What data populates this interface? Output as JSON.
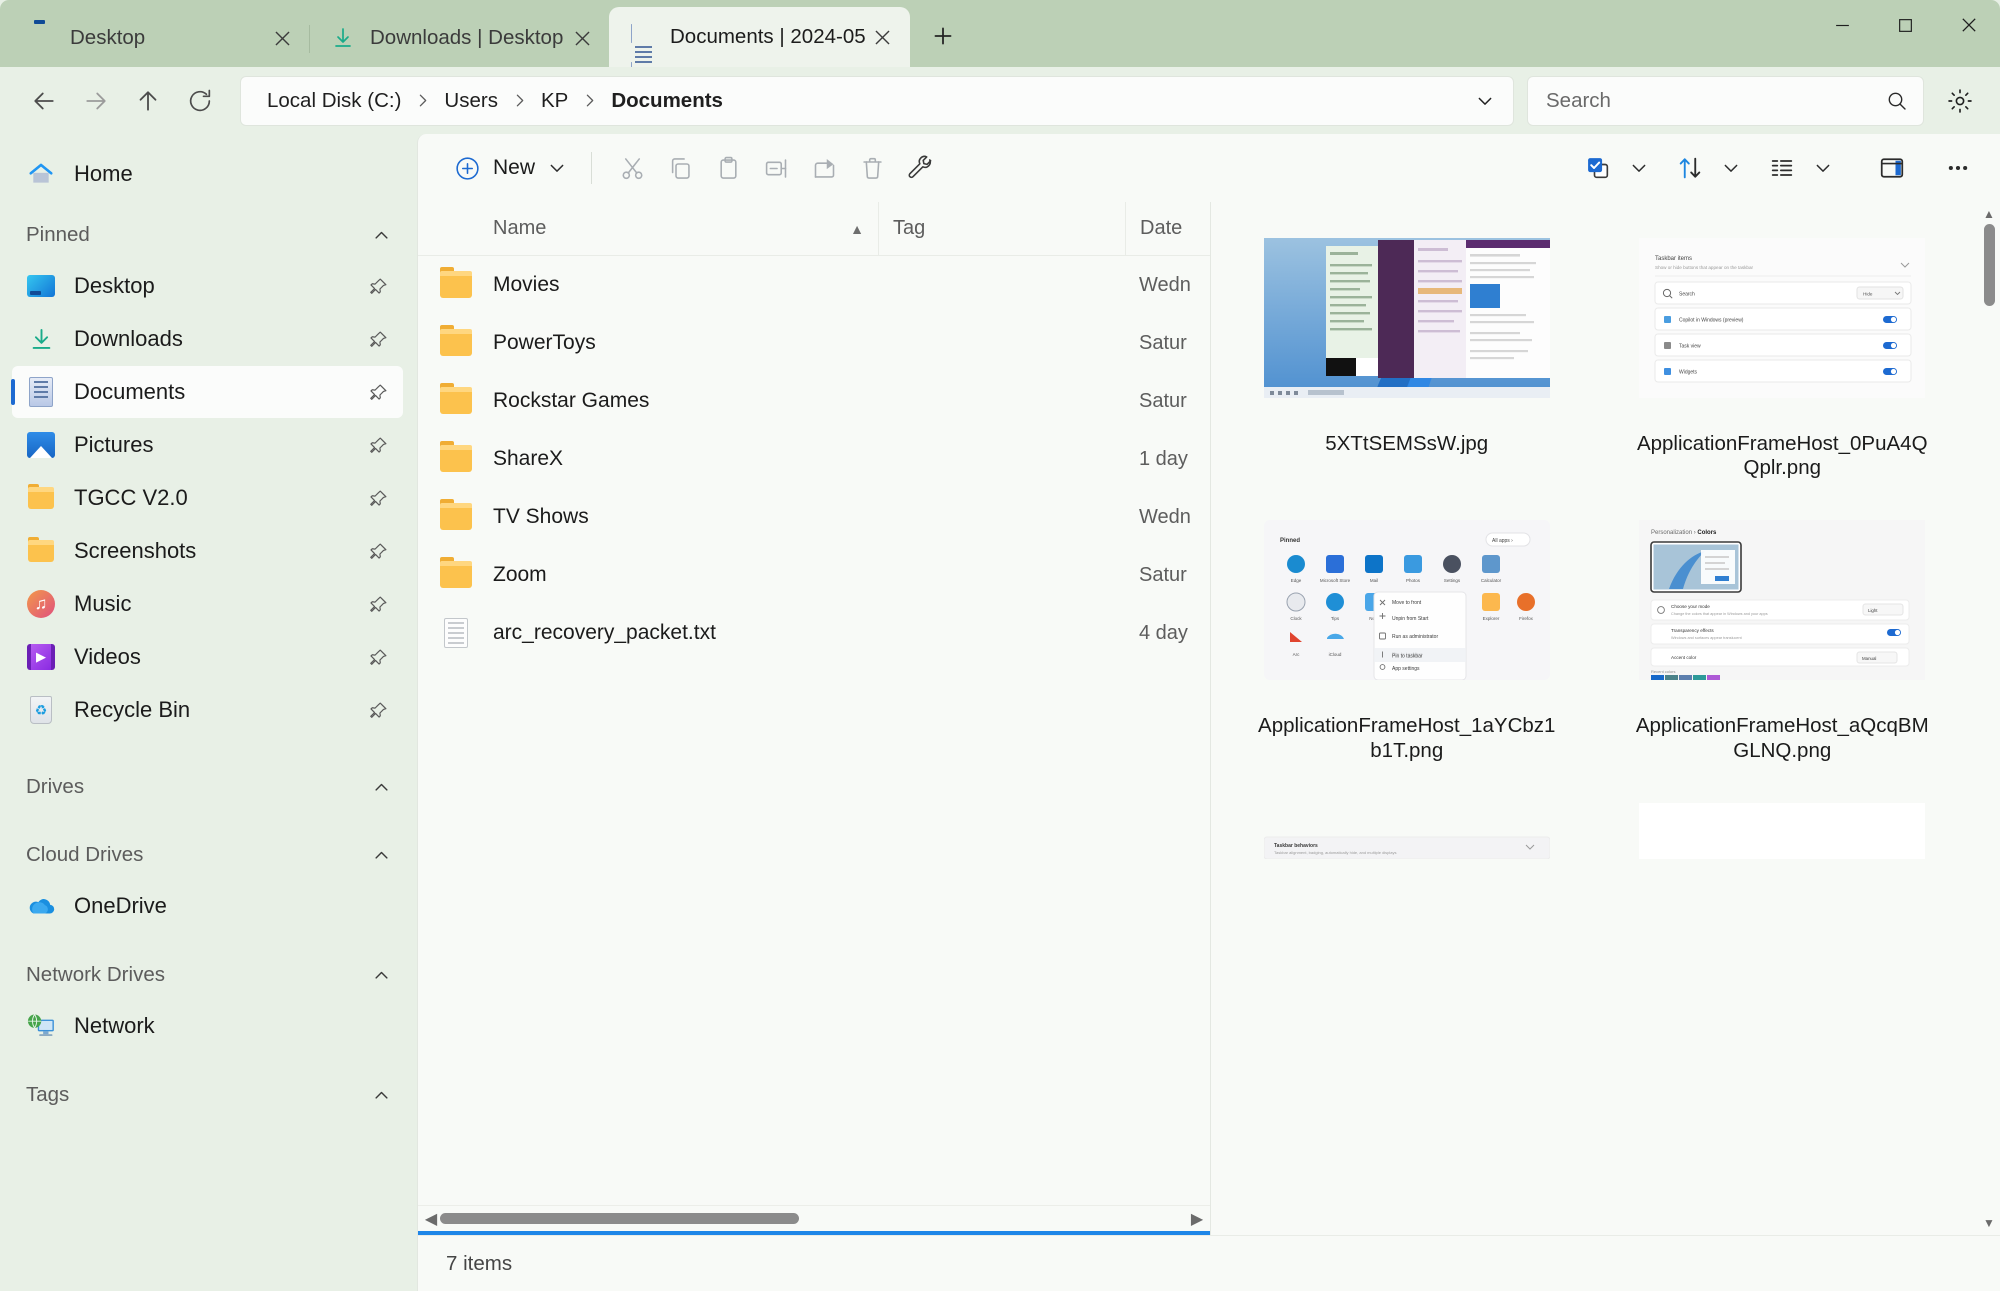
{
  "window": {
    "controls": {
      "minimize": "minimize-button",
      "maximize": "maximize-button",
      "close": "close-button"
    }
  },
  "tabs": [
    {
      "label": "Desktop",
      "icon": "desktop-icon",
      "active": false
    },
    {
      "label": "Downloads | Desktop",
      "icon": "download-icon",
      "active": false
    },
    {
      "label": "Documents | 2024-05",
      "icon": "document-icon",
      "active": true
    }
  ],
  "new_tab_label": "+",
  "address": {
    "back": "back-arrow",
    "forward": "forward-arrow",
    "up": "up-arrow",
    "refresh": "refresh-icon",
    "crumbs": [
      "Local Disk (C:)",
      "Users",
      "KP",
      "Documents"
    ],
    "dropdown": "chevron-down-icon"
  },
  "search": {
    "placeholder": "Search",
    "value": "",
    "icon": "search-icon"
  },
  "settings_icon": "gear-icon",
  "sidebar": {
    "home": {
      "label": "Home",
      "icon": "home-icon"
    },
    "sections": [
      {
        "title": "Pinned",
        "items": [
          {
            "label": "Desktop",
            "icon": "desktop-icon",
            "pinned": true,
            "selected": false
          },
          {
            "label": "Downloads",
            "icon": "download-icon",
            "pinned": true,
            "selected": false
          },
          {
            "label": "Documents",
            "icon": "document-icon",
            "pinned": true,
            "selected": true
          },
          {
            "label": "Pictures",
            "icon": "pictures-icon",
            "pinned": true,
            "selected": false
          },
          {
            "label": "TGCC V2.0",
            "icon": "folder-icon",
            "pinned": true,
            "selected": false
          },
          {
            "label": "Screenshots",
            "icon": "folder-icon",
            "pinned": true,
            "selected": false
          },
          {
            "label": "Music",
            "icon": "music-icon",
            "pinned": true,
            "selected": false
          },
          {
            "label": "Videos",
            "icon": "video-icon",
            "pinned": true,
            "selected": false
          },
          {
            "label": "Recycle Bin",
            "icon": "recycle-bin-icon",
            "pinned": true,
            "selected": false
          }
        ]
      },
      {
        "title": "Drives",
        "items": []
      },
      {
        "title": "Cloud Drives",
        "items": [
          {
            "label": "OneDrive",
            "icon": "onedrive-icon",
            "pinned": false,
            "selected": false
          }
        ]
      },
      {
        "title": "Network Drives",
        "items": [
          {
            "label": "Network",
            "icon": "network-icon",
            "pinned": false,
            "selected": false
          }
        ]
      },
      {
        "title": "Tags",
        "items": []
      }
    ]
  },
  "toolbar": {
    "new_label": "New",
    "new_icon": "plus-circle-icon",
    "new_chevron": "chevron-down-icon",
    "commands": [
      {
        "name": "cut-button",
        "icon": "scissors-icon",
        "enabled": false
      },
      {
        "name": "copy-button",
        "icon": "copy-icon",
        "enabled": false
      },
      {
        "name": "paste-button",
        "icon": "clipboard-icon",
        "enabled": false
      },
      {
        "name": "rename-button",
        "icon": "rename-icon",
        "enabled": false
      },
      {
        "name": "share-button",
        "icon": "share-icon",
        "enabled": false
      },
      {
        "name": "delete-button",
        "icon": "trash-icon",
        "enabled": false
      },
      {
        "name": "tools-button",
        "icon": "wrench-icon",
        "enabled": true
      }
    ],
    "right": [
      {
        "name": "select-button",
        "icon": "checkbox-select-icon",
        "chevron": true
      },
      {
        "name": "sort-button",
        "icon": "sort-arrows-icon",
        "chevron": true
      },
      {
        "name": "view-button",
        "icon": "list-view-icon",
        "chevron": true
      },
      {
        "name": "preview-pane-button",
        "icon": "preview-pane-icon",
        "chevron": false
      },
      {
        "name": "more-button",
        "icon": "ellipsis-icon",
        "chevron": false
      }
    ]
  },
  "filelist": {
    "columns": [
      {
        "key": "name",
        "label": "Name",
        "sort": "ascending",
        "sort_glyph": "▲"
      },
      {
        "key": "tag",
        "label": "Tag",
        "sort": "none",
        "sort_glyph": ""
      },
      {
        "key": "date",
        "label": "Date",
        "sort": "none",
        "sort_glyph": ""
      }
    ],
    "rows": [
      {
        "name": "Movies",
        "icon": "folder-icon",
        "tag": "",
        "date": "Wedn"
      },
      {
        "name": "PowerToys",
        "icon": "folder-icon",
        "tag": "",
        "date": "Satur"
      },
      {
        "name": "Rockstar Games",
        "icon": "folder-icon",
        "tag": "",
        "date": "Satur"
      },
      {
        "name": "ShareX",
        "icon": "folder-icon",
        "tag": "",
        "date": "1 day"
      },
      {
        "name": "TV Shows",
        "icon": "folder-icon",
        "tag": "",
        "date": "Wedn"
      },
      {
        "name": "Zoom",
        "icon": "folder-icon",
        "tag": "",
        "date": "Satur"
      },
      {
        "name": "arc_recovery_packet.txt",
        "icon": "text-file-icon",
        "tag": "",
        "date": "4 day"
      }
    ]
  },
  "preview": {
    "items": [
      {
        "name": "5XTtSEMSsW.jpg",
        "thumb": "desktop-teams-screenshot"
      },
      {
        "name": "ApplicationFrameHost_0PuA4QQplr.png",
        "thumb": "settings-taskbar-screenshot"
      },
      {
        "name": "ApplicationFrameHost_1aYCbz1b1T.png",
        "thumb": "start-menu-context-screenshot"
      },
      {
        "name": "ApplicationFrameHost_aQcqBMGLNQ.png",
        "thumb": "personalization-colors-screenshot"
      },
      {
        "name": "",
        "thumb": "taskbar-behaviors-screenshot-partial"
      },
      {
        "name": "",
        "thumb": "blank-screenshot-partial"
      }
    ]
  },
  "status": {
    "item_count": "7 items"
  },
  "colors": {
    "titlebar": "#bcd0b6",
    "chrome": "#e8f0e6",
    "content": "#f8faf7",
    "accent": "#1d6ad1",
    "focus_line": "#1e86e8",
    "folder": "#fcc24d"
  }
}
